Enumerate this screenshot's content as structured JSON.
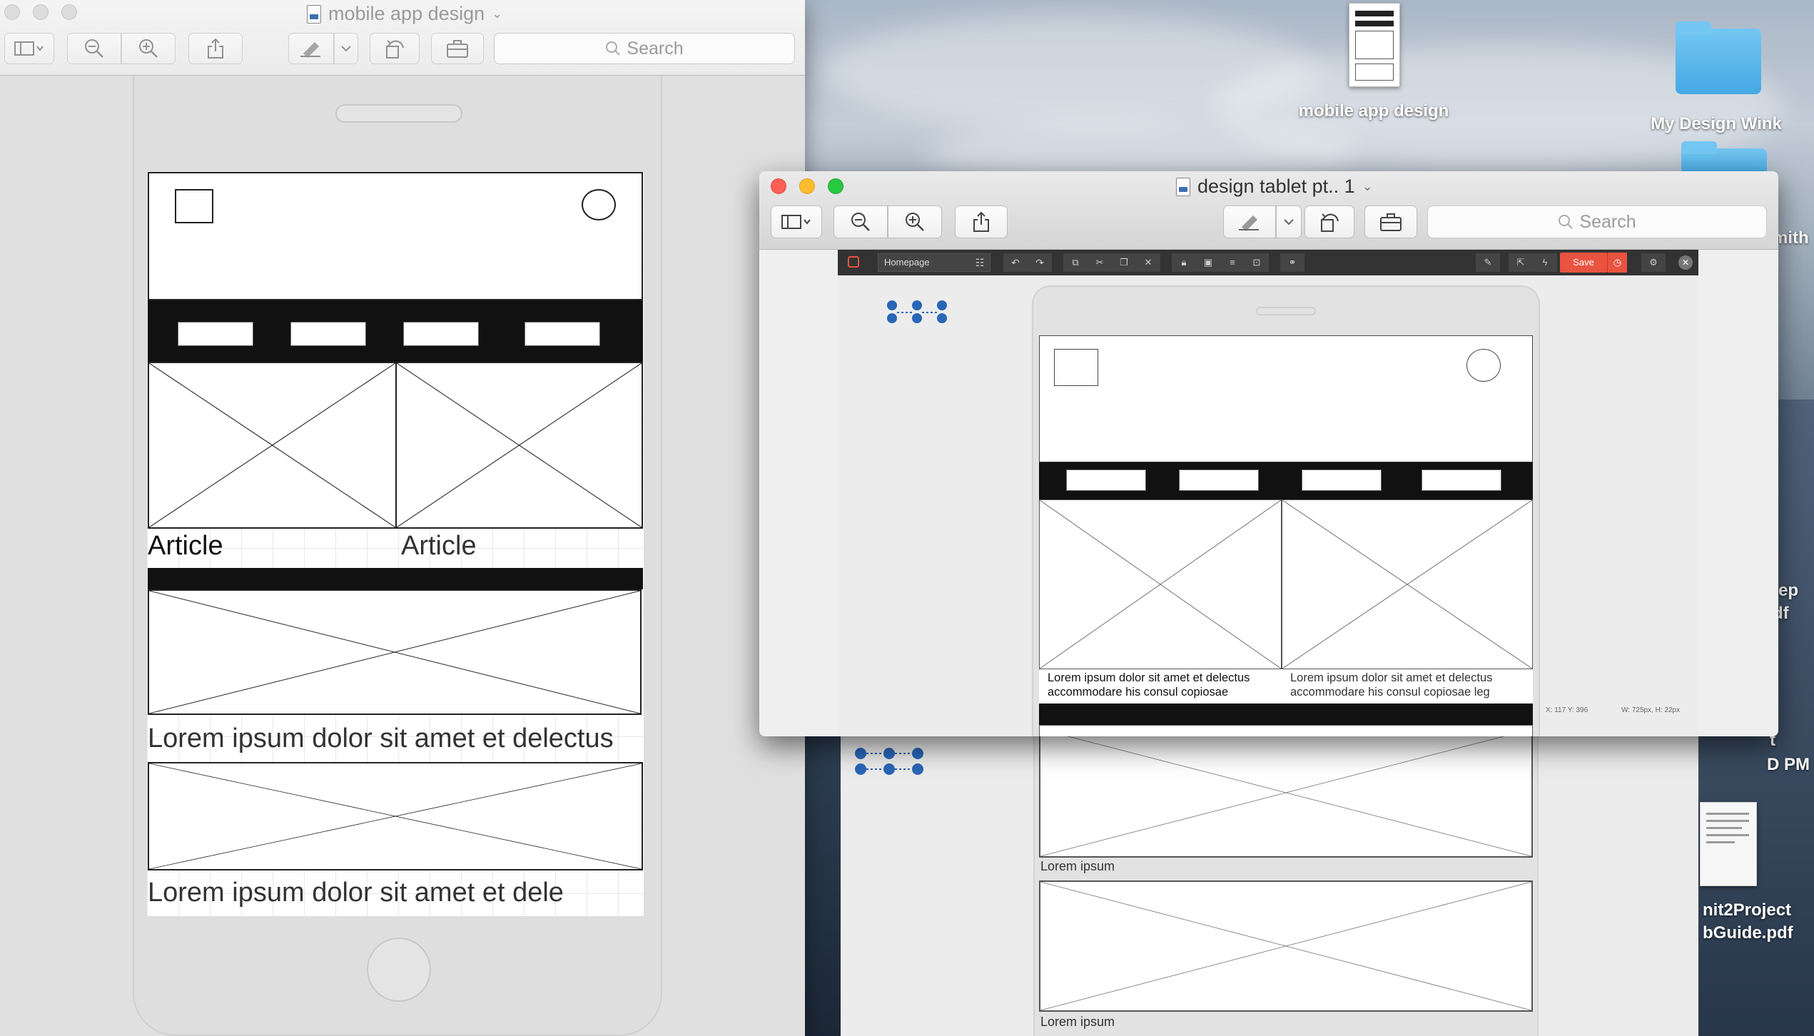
{
  "desktop": {
    "icons": [
      {
        "label": "mobile app design"
      },
      {
        "label": "My Design Wink"
      },
      {
        "label": "mith"
      },
      {
        "label": "tep"
      },
      {
        "label": "df"
      },
      {
        "label": "t"
      },
      {
        "label": "D PM"
      },
      {
        "label": "nit2Project"
      },
      {
        "label": "bGuide.pdf"
      }
    ]
  },
  "win1": {
    "title": "mobile app design",
    "search_placeholder": "Search",
    "wireframe": {
      "article1": "Article",
      "article2": "Article",
      "lorem1": "Lorem ipsum dolor sit amet et delectus",
      "lorem2": "Lorem ipsum dolor sit amet et dele"
    }
  },
  "win2": {
    "title": "design tablet pt.. 1",
    "search_placeholder": "Search",
    "editor": {
      "page_name": "Homepage",
      "save_label": "Save",
      "status_xy": "X: 117 Y: 396",
      "status_wh": "W: 725px, H: 22px",
      "text_col1": "Lorem ipsum dolor sit amet et delectus accommodare his consul copiosae",
      "text_col2": "Lorem ipsum dolor sit amet et delectus accommodare his consul copiosae leg"
    }
  },
  "behind": {
    "caption1": "Lorem ipsum",
    "caption2": "Lorem ipsum"
  }
}
